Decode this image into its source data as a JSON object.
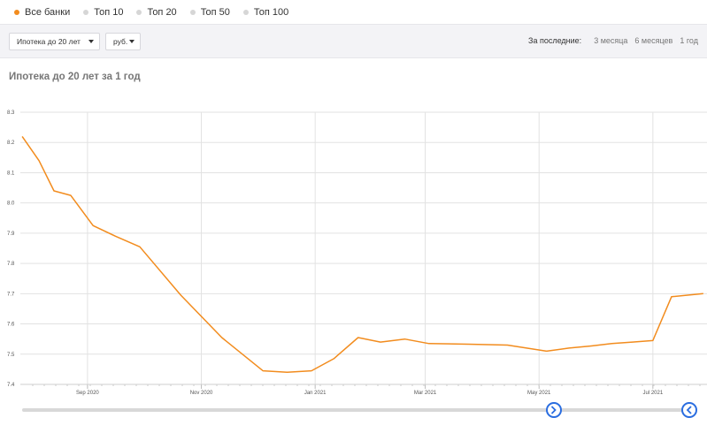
{
  "tabs": [
    {
      "label": "Все банки",
      "active": true,
      "color": "#f28c1e"
    },
    {
      "label": "Топ 10",
      "active": false,
      "color": "#d6d6d6"
    },
    {
      "label": "Топ 20",
      "active": false,
      "color": "#d6d6d6"
    },
    {
      "label": "Топ 50",
      "active": false,
      "color": "#d6d6d6"
    },
    {
      "label": "Топ 100",
      "active": false,
      "color": "#d6d6d6"
    }
  ],
  "controls": {
    "product_select": "Ипотека до 20 лет",
    "currency_select": "руб.",
    "period_label": "За последние:",
    "period_options": [
      "3 месяца",
      "6 месяцев",
      "1 год"
    ]
  },
  "chart_title": "Ипотека до 20 лет за 1 год",
  "chart_data": {
    "type": "line",
    "title": "Ипотека до 20 лет за 1 год",
    "xlabel": "",
    "ylabel": "",
    "x_type": "datetime",
    "x_range": [
      "2020-07-27",
      "2021-07-30"
    ],
    "ylim": [
      7.4,
      8.3
    ],
    "y_ticks": [
      7.4,
      7.5,
      7.6,
      7.7,
      7.8,
      7.9,
      8.0,
      8.1,
      8.2,
      8.3
    ],
    "x_ticks": [
      {
        "date": "2020-09-01",
        "label": "Sep 2020"
      },
      {
        "date": "2020-11-01",
        "label": "Nov 2020"
      },
      {
        "date": "2021-01-01",
        "label": "Jan 2021"
      },
      {
        "date": "2021-03-01",
        "label": "Mar 2021"
      },
      {
        "date": "2021-05-01",
        "label": "May 2021"
      },
      {
        "date": "2021-07-01",
        "label": "Jul 2021"
      }
    ],
    "grid": true,
    "line_color": "#f28c1e",
    "series": [
      {
        "points": [
          [
            "2020-07-28",
            8.22
          ],
          [
            "2020-08-06",
            8.14
          ],
          [
            "2020-08-14",
            8.04
          ],
          [
            "2020-08-23",
            8.025
          ],
          [
            "2020-09-04",
            7.925
          ],
          [
            "2020-09-16",
            7.89
          ],
          [
            "2020-09-29",
            7.855
          ],
          [
            "2020-10-21",
            7.695
          ],
          [
            "2020-11-12",
            7.555
          ],
          [
            "2020-12-04",
            7.445
          ],
          [
            "2020-12-17",
            7.44
          ],
          [
            "2020-12-30",
            7.445
          ],
          [
            "2021-01-11",
            7.485
          ],
          [
            "2021-01-24",
            7.555
          ],
          [
            "2021-02-05",
            7.54
          ],
          [
            "2021-02-18",
            7.55
          ],
          [
            "2021-03-03",
            7.535
          ],
          [
            "2021-03-24",
            7.533
          ],
          [
            "2021-04-14",
            7.53
          ],
          [
            "2021-05-05",
            7.51
          ],
          [
            "2021-05-17",
            7.52
          ],
          [
            "2021-05-29",
            7.527
          ],
          [
            "2021-06-09",
            7.535
          ],
          [
            "2021-06-20",
            7.54
          ],
          [
            "2021-07-01",
            7.545
          ],
          [
            "2021-07-11",
            7.69
          ],
          [
            "2021-07-28",
            7.7
          ]
        ]
      }
    ]
  }
}
